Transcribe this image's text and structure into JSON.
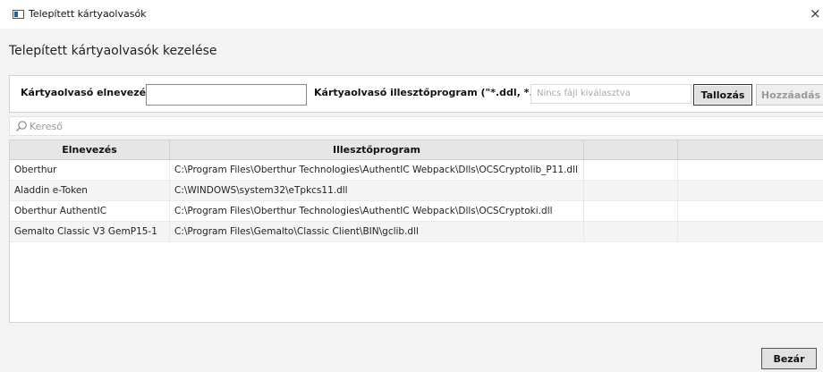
{
  "window": {
    "title": "Telepített kártyaolvasók",
    "close_glyph": "×"
  },
  "page": {
    "title": "Telepített kártyaolvasók kezelése"
  },
  "form": {
    "name_label": "Kártyaolvasó elnevezése",
    "name_value": "",
    "driver_label": "Kártyaolvasó illesztőprogram (\"*.ddl, *.so\")",
    "driver_placeholder": "Nincs fájl kiválasztva",
    "browse_label": "Tallozás",
    "add_label": "Hozzáadás"
  },
  "search": {
    "placeholder": "Kereső"
  },
  "table": {
    "columns": [
      "Elnevezés",
      "Illesztőprogram",
      "",
      ""
    ],
    "rows": [
      {
        "name": "Oberthur",
        "driver": "C:\\Program Files\\Oberthur Technologies\\AuthentIC Webpack\\Dlls\\OCSCryptolib_P11.dll"
      },
      {
        "name": "Aladdin e-Token",
        "driver": "C:\\WINDOWS\\system32\\eTpkcs11.dll"
      },
      {
        "name": "Oberthur AuthentIC",
        "driver": "C:\\Program Files\\Oberthur Technologies\\AuthentIC Webpack\\Dlls\\OCSCryptoki.dll"
      },
      {
        "name": "Gemalto Classic V3 GemP15-1",
        "driver": "C:\\Program Files\\Gemalto\\Classic Client\\BIN\\gclib.dll"
      }
    ]
  },
  "footer": {
    "close_label": "Bezár"
  },
  "icons": {
    "app": "smart-card-reader-icon",
    "search": "search-icon",
    "close": "close-icon"
  }
}
